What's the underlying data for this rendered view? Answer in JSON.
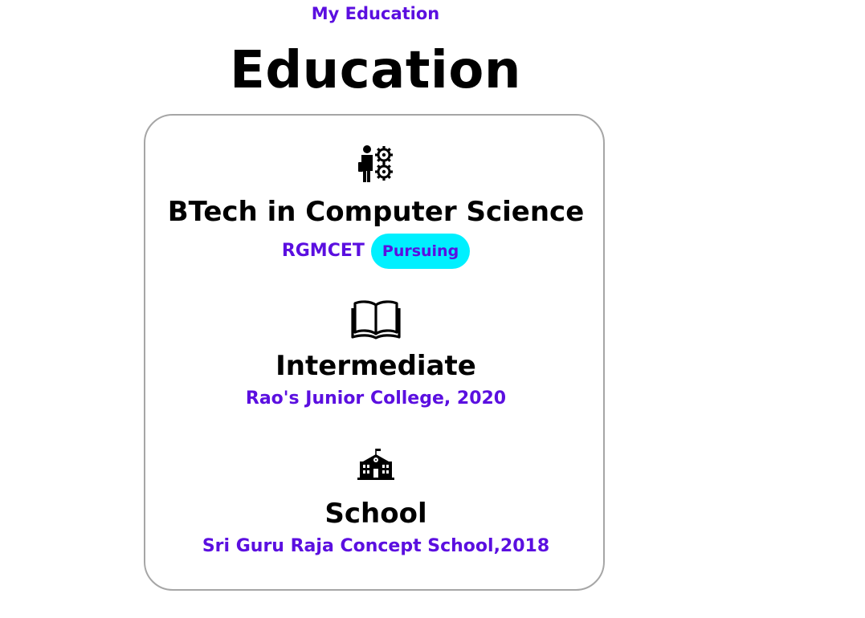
{
  "header": {
    "kicker": "My Education",
    "title": "Education"
  },
  "education": [
    {
      "icon": "engineer-gears-icon",
      "title": "BTech in Computer Science",
      "institution": "RGMCET",
      "status_badge": "Pursuing"
    },
    {
      "icon": "open-book-icon",
      "title": "Intermediate",
      "detail": "Rao's Junior College, 2020"
    },
    {
      "icon": "school-building-icon",
      "title": "School",
      "detail": "Sri Guru Raja Concept School,2018"
    }
  ],
  "colors": {
    "accent": "#5b0fe0",
    "badge_bg": "#00f0ff",
    "card_border": "#a6a6a6",
    "text": "#000000"
  }
}
